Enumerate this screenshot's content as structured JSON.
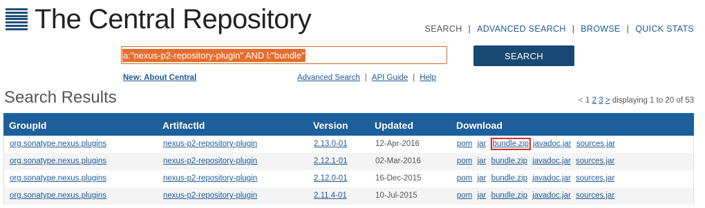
{
  "logo": {
    "title": "The Central Repository"
  },
  "topnav": {
    "items": [
      "SEARCH",
      "ADVANCED SEARCH",
      "BROWSE",
      "QUICK STATS"
    ],
    "separator": "|"
  },
  "search": {
    "query": "a:\"nexus-p2-repository-plugin\" AND l:\"bundle\"",
    "button": "SEARCH"
  },
  "sublinks": {
    "about": "New: About Central",
    "links": [
      "Advanced Search",
      "API Guide",
      "Help"
    ],
    "separator": "|"
  },
  "results": {
    "title": "Search Results",
    "pagination": {
      "prev": "<",
      "pages": [
        "1",
        "2",
        "3"
      ],
      "next": ">",
      "summary": "displaying 1 to 20 of 53"
    },
    "columns": [
      "GroupId",
      "ArtifactId",
      "Version",
      "Updated",
      "Download"
    ],
    "rows": [
      {
        "groupId": "org.sonatype.nexus.plugins",
        "artifactId": "nexus-p2-repository-plugin",
        "version": "2.13.0-01",
        "updated": "12-Apr-2016",
        "downloads": [
          "pom",
          "jar",
          "bundle.zip",
          "javadoc.jar",
          "sources.jar"
        ]
      },
      {
        "groupId": "org.sonatype.nexus.plugins",
        "artifactId": "nexus-p2-repository-plugin",
        "version": "2.12.1-01",
        "updated": "02-Mar-2016",
        "downloads": [
          "pom",
          "jar",
          "bundle.zip",
          "javadoc.jar",
          "sources.jar"
        ]
      },
      {
        "groupId": "org.sonatype.nexus.plugins",
        "artifactId": "nexus-p2-repository-plugin",
        "version": "2.12.0-01",
        "updated": "16-Dec-2015",
        "downloads": [
          "pom",
          "jar",
          "bundle.zip",
          "javadoc.jar",
          "sources.jar"
        ]
      },
      {
        "groupId": "org.sonatype.nexus.plugins",
        "artifactId": "nexus-p2-repository-plugin",
        "version": "2.11.4-01",
        "updated": "10-Jul-2015",
        "downloads": [
          "pom",
          "jar",
          "bundle.zip",
          "javadoc.jar",
          "sources.jar"
        ]
      }
    ]
  },
  "colors": {
    "header_bg": "#1d5f9b",
    "button_bg": "#184974",
    "link": "#1e5a96",
    "query_highlight": "#e46e2f",
    "highlight_box": "#d62a24"
  }
}
